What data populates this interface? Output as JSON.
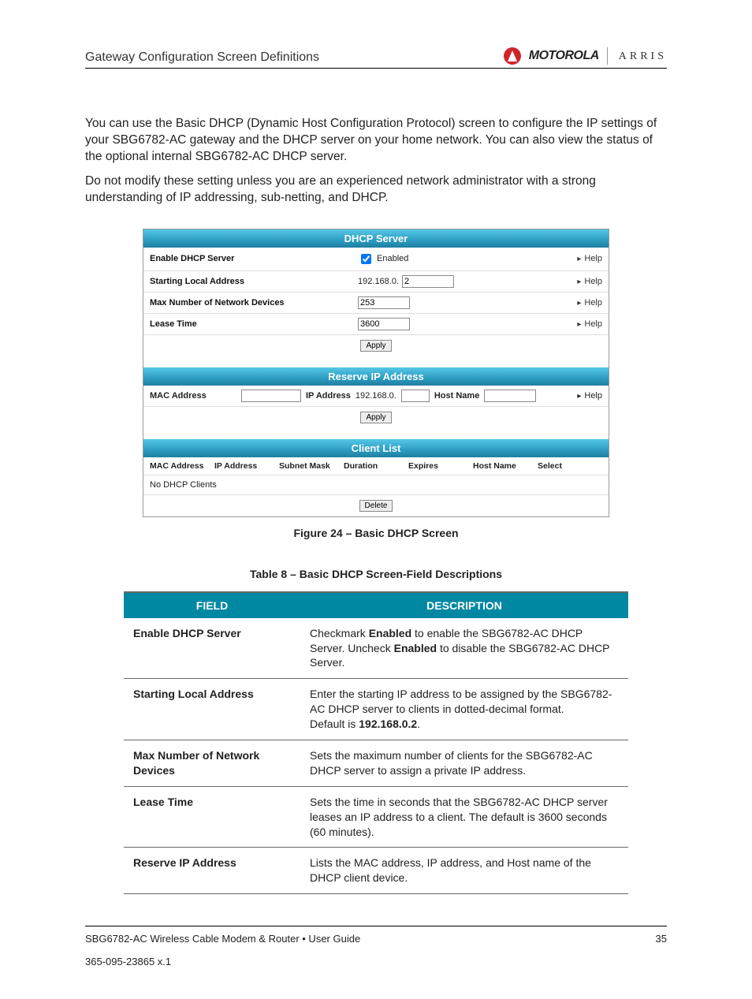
{
  "header": {
    "title": "Gateway Configuration Screen Definitions",
    "brand1": "MOTOROLA",
    "brand2": "ARRIS"
  },
  "intro": {
    "p1": "You can use the Basic DHCP (Dynamic Host Configuration Protocol) screen to configure the IP settings of your SBG6782-AC gateway and the DHCP server on your home network. You can also view the status of the optional internal SBG6782-AC DHCP server.",
    "p2": "Do not modify these setting unless you are an experienced network administrator with a strong understanding of IP addressing, sub-netting, and DHCP."
  },
  "dhcp": {
    "section1": "DHCP Server",
    "enable_label": "Enable DHCP Server",
    "enable_checked": true,
    "enable_text": "Enabled",
    "start_label": "Starting Local Address",
    "start_prefix": "192.168.0.",
    "start_value": "2",
    "max_label": "Max Number of Network Devices",
    "max_value": "253",
    "lease_label": "Lease Time",
    "lease_value": "3600",
    "apply": "Apply",
    "help": "Help",
    "section2": "Reserve IP Address",
    "mac_label": "MAC Address",
    "ip_label": "IP Address",
    "ip_prefix": "192.168.0.",
    "host_label": "Host Name",
    "section3": "Client List",
    "cols": {
      "mac": "MAC Address",
      "ip": "IP Address",
      "subnet": "Subnet Mask",
      "duration": "Duration",
      "expires": "Expires",
      "host": "Host Name",
      "select": "Select"
    },
    "noclients": "No DHCP Clients",
    "delete": "Delete"
  },
  "figure_caption": "Figure 24 – Basic DHCP Screen",
  "table_caption": "Table 8 – Basic DHCP Screen-Field Descriptions",
  "table_head": {
    "field": "FIELD",
    "desc": "DESCRIPTION"
  },
  "rows": [
    {
      "field": "Enable DHCP Server",
      "desc_parts": [
        "Checkmark ",
        "Enabled",
        " to enable the SBG6782-AC DHCP Server. Uncheck ",
        "Enabled",
        " to disable the SBG6782-AC DHCP Server."
      ]
    },
    {
      "field": "Starting Local Address",
      "desc_parts": [
        "Enter the starting IP address to be assigned by the SBG6782-AC DHCP server to clients in dotted-decimal format.",
        " Default is ",
        "192.168.0.2",
        "."
      ]
    },
    {
      "field": "Max Number of Network Devices",
      "desc": "Sets the maximum number of clients for the SBG6782-AC DHCP server to assign a private IP address."
    },
    {
      "field": "Lease Time",
      "desc": "Sets the time in seconds that the SBG6782-AC DHCP server leases an IP address to a client. The default is 3600 seconds (60 minutes)."
    },
    {
      "field": "Reserve IP Address",
      "desc": "Lists the MAC address, IP address, and Host name of the DHCP client device."
    }
  ],
  "footer": {
    "left": "SBG6782-AC Wireless Cable Modem & Router • User Guide",
    "right": "35",
    "docnum": "365-095-23865  x.1"
  }
}
